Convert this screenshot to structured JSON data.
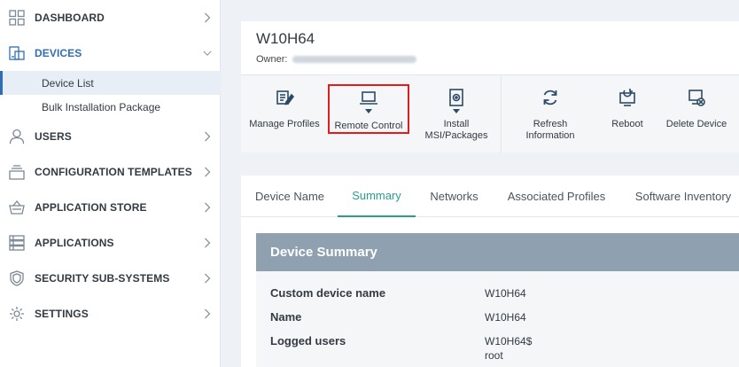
{
  "sidebar": {
    "items": [
      {
        "label": "DASHBOARD",
        "icon": "grid-icon"
      },
      {
        "label": "DEVICES",
        "icon": "devices-icon"
      },
      {
        "label": "USERS",
        "icon": "user-icon"
      },
      {
        "label": "CONFIGURATION TEMPLATES",
        "icon": "layers-icon"
      },
      {
        "label": "APPLICATION STORE",
        "icon": "basket-icon"
      },
      {
        "label": "APPLICATIONS",
        "icon": "apps-icon"
      },
      {
        "label": "SECURITY SUB-SYSTEMS",
        "icon": "shield-icon"
      },
      {
        "label": "SETTINGS",
        "icon": "gear-icon"
      }
    ],
    "sub_items": [
      {
        "label": "Device List"
      },
      {
        "label": "Bulk Installation Package"
      }
    ]
  },
  "device": {
    "name": "W10H64",
    "owner_label": "Owner:"
  },
  "toolbar": {
    "manage_profiles": "Manage Profiles",
    "remote_control": "Remote Control",
    "install_msi": "Install\nMSI/Packages",
    "refresh_information": "Refresh\nInformation",
    "reboot": "Reboot",
    "delete_device": "Delete Device"
  },
  "tabs": [
    {
      "label": "Device Name"
    },
    {
      "label": "Summary"
    },
    {
      "label": "Networks"
    },
    {
      "label": "Associated Profiles"
    },
    {
      "label": "Software Inventory"
    }
  ],
  "summary": {
    "title": "Device Summary",
    "rows": [
      {
        "key": "Custom device name",
        "value": "W10H64"
      },
      {
        "key": "Name",
        "value": "W10H64"
      },
      {
        "key": "Logged users",
        "value": "W10H64$\nroot"
      }
    ]
  },
  "colors": {
    "accent": "#2f6eb5",
    "tab_active": "#2a9d8f",
    "highlight": "#e21b1b",
    "summary_header": "#8fa0b0"
  }
}
